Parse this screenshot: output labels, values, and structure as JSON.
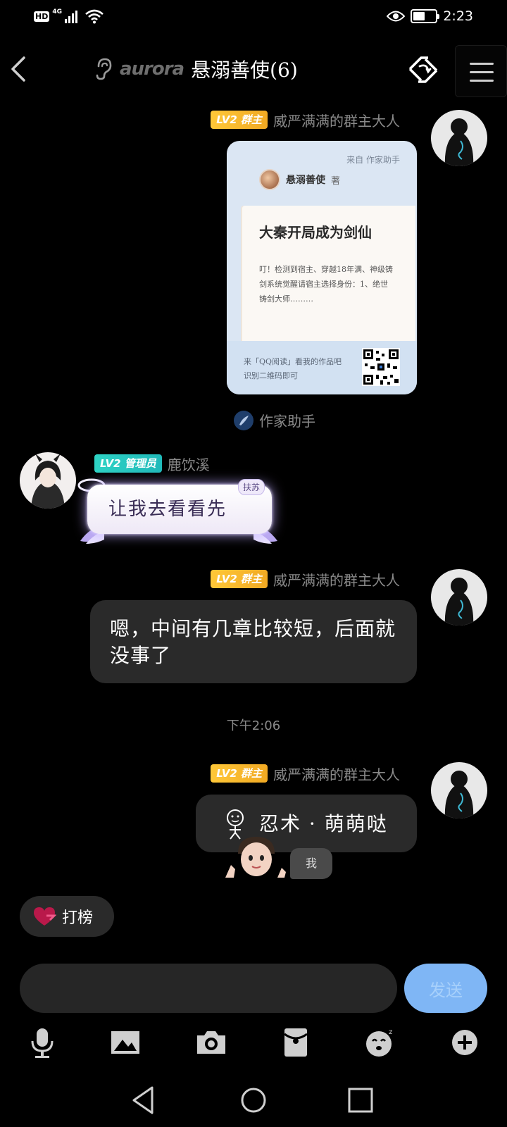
{
  "status_bar": {
    "hd": "HD",
    "network": "4G",
    "time": "2:23",
    "battery_level": 0.45
  },
  "header": {
    "brand": "aurora",
    "title": "悬溺善使(6)"
  },
  "messages": {
    "card_msg": {
      "badge": "LV2 群主",
      "sender": "威严满满的群主大人",
      "card": {
        "from": "来自  作家助手",
        "author": "悬溺善使",
        "author_suffix": "著",
        "book_title": "大秦开局成为剑仙",
        "book_excerpt": "叮！检测到宿主、穿越18年满、神级铸剑系统觉醒请宿主选择身份：1、绝世铸剑大师………",
        "footer_line1": "来「QQ阅读」看我的作品吧",
        "footer_line2": "识别二维码即可"
      },
      "source": "作家助手"
    },
    "admin_msg": {
      "badge": "LV2 管理员",
      "sender": "鹿饮溪",
      "text": "让我去看看先",
      "tag": "扶苏"
    },
    "owner_msg_1": {
      "badge": "LV2 群主",
      "sender": "威严满满的群主大人",
      "text": "嗯，中间有几章比较短，后面就没事了"
    },
    "timestamp": "下午2:06",
    "owner_msg_2": {
      "badge": "LV2 群主",
      "sender": "威严满满的群主大人",
      "text": "忍术 · 萌萌哒",
      "me_tag": "我"
    }
  },
  "rank_button": {
    "label": "打榜"
  },
  "input": {
    "send_label": "发送"
  },
  "toolbar": [
    "mic-icon",
    "image-icon",
    "camera-icon",
    "red-packet-icon",
    "emoji-icon",
    "plus-icon"
  ],
  "colors": {
    "owner_badge": "#f5b52a",
    "admin_badge": "#26c6be",
    "send_button": "#7fb6f5",
    "bubble": "#2a2a2a"
  }
}
